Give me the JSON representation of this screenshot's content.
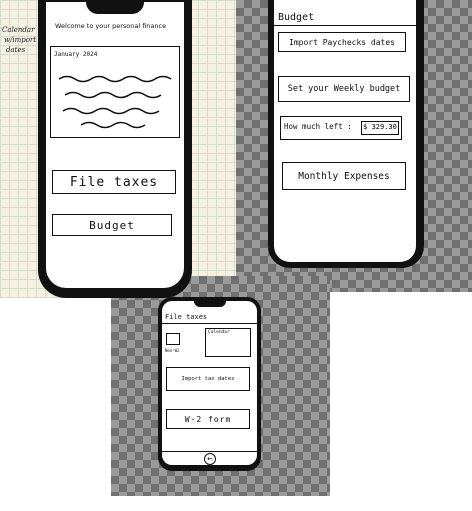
{
  "sketch_home": {
    "margin_notes": [
      "Calendar",
      "w/import",
      "dates"
    ],
    "title": "Welcome to your personal finance",
    "calendar_label": "January 2024",
    "file_taxes_button": "File taxes",
    "budget_button": "Budget"
  },
  "sketch_budget": {
    "title": "Budget",
    "import_button": "Import Paychecks dates",
    "weekly_budget_button": "Set your Weekly budget",
    "how_much_left_label": "How much left :",
    "how_much_left_value": "$ 329.30",
    "monthly_expenses_button": "Monthly Expenses"
  },
  "sketch_taxes": {
    "title": "File taxes",
    "checkbox_label": "Non-W2",
    "calendar_label": "Calendar",
    "import_button": "Import tax dates",
    "w2_button": "W-2 form",
    "home_button_icon": "back-arrow-icon"
  }
}
